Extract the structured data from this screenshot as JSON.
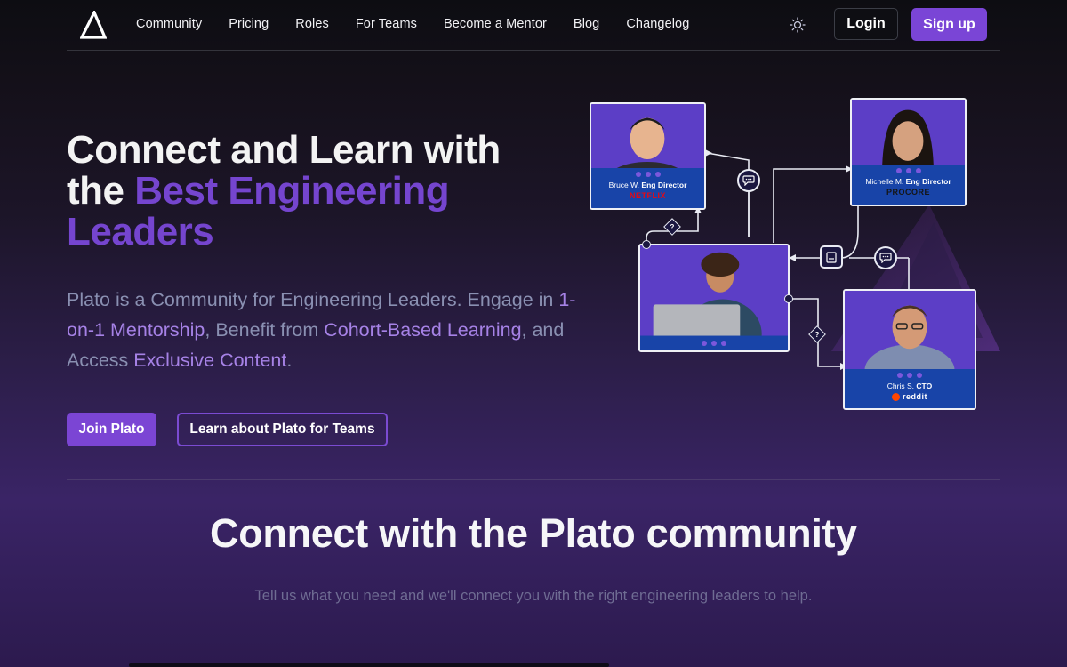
{
  "nav": {
    "links": [
      "Community",
      "Pricing",
      "Roles",
      "For Teams",
      "Become a Mentor",
      "Blog",
      "Changelog"
    ],
    "theme_icon": "sun-icon",
    "login_label": "Login",
    "signup_label": "Sign up"
  },
  "hero": {
    "title_line1": "Connect and Learn with",
    "title_the": "the ",
    "title_accent": "Best Engineering Leaders",
    "desc_1": "Plato is a Community for Engineering Leaders. Engage in ",
    "desc_hl_1": "1-on-1 Mentorship",
    "desc_2": ", Benefit from ",
    "desc_hl_2": "Cohort-Based Learning",
    "desc_3": ", and Access ",
    "desc_hl_3": "Exclusive Content",
    "desc_4": ".",
    "join_label": "Join Plato",
    "teams_label": "Learn about Plato for Teams"
  },
  "mentors": [
    {
      "name": "Bruce W.",
      "role": "Eng Director",
      "company": "NETFLIX"
    },
    {
      "name": "Michelle M.",
      "role": "Eng Director",
      "company": "PROCORE"
    },
    {
      "name": "Chris S.",
      "role": "CTO",
      "company": "reddit"
    }
  ],
  "diagram": {
    "question_mark": "?"
  },
  "section": {
    "title": "Connect with the Plato community",
    "subtitle": "Tell us what you need and we'll connect you with the right engineering leaders to help."
  },
  "colors": {
    "accent": "#7545cf",
    "button_primary": "#7b45d4",
    "desc_text": "#8a90b2",
    "desc_highlight": "#a682e6"
  }
}
